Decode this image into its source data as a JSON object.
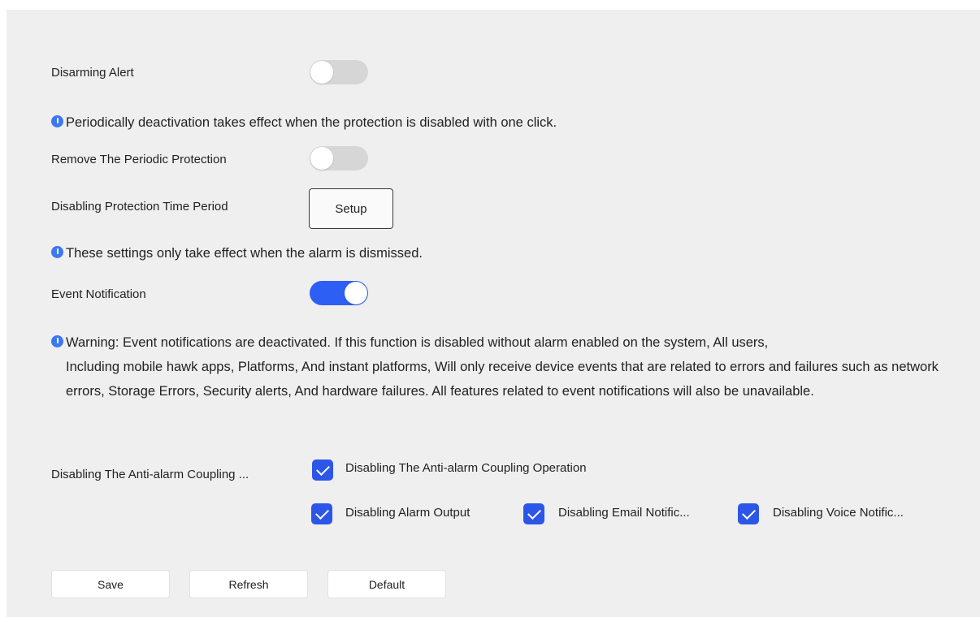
{
  "disarming_alert": {
    "label": "Disarming Alert",
    "enabled": false
  },
  "notice_periodic": "Periodically deactivation takes effect when the protection is disabled with one click.",
  "remove_periodic": {
    "label": "Remove The Periodic Protection",
    "enabled": false
  },
  "disabling_period": {
    "label": "Disabling Protection Time Period",
    "button": "Setup"
  },
  "notice_alarm": "These settings only take effect when the alarm is dismissed.",
  "event_notification": {
    "label": "Event Notification",
    "enabled": true
  },
  "warning": {
    "first": "Warning: Event notifications are deactivated. If this function is disabled without alarm enabled on the system, All users,",
    "rest": "Including mobile hawk apps, Platforms, And instant platforms, Will only receive device events that are related to errors and failures such as network errors, Storage Errors, Security alerts, And hardware failures. All features related to event notifications will also be unavailable."
  },
  "anti_alarm": {
    "label": "Disabling The Anti-alarm Coupling ...",
    "options": [
      {
        "label": "Disabling The Anti-alarm Coupling Operation",
        "checked": true
      },
      {
        "label": "Disabling Alarm Output",
        "checked": true
      },
      {
        "label": "Disabling Email Notific...",
        "checked": true
      },
      {
        "label": "Disabling Voice Notific...",
        "checked": true
      }
    ]
  },
  "footer": {
    "save": "Save",
    "refresh": "Refresh",
    "default": "Default"
  },
  "colors": {
    "accent": "#2e5ff5",
    "info": "#3d78f0",
    "toggle_off": "#d6d6d6",
    "panel": "#efefef"
  }
}
